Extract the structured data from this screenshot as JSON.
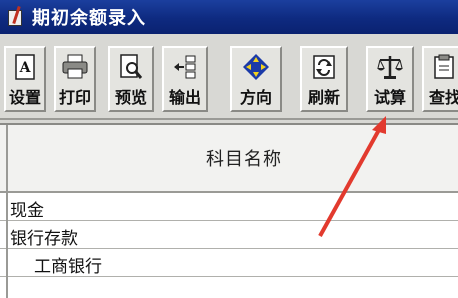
{
  "window": {
    "title": "期初余额录入"
  },
  "toolbar": {
    "buttons": [
      {
        "label": "设置",
        "icon": "settings-doc-icon"
      },
      {
        "label": "打印",
        "icon": "printer-icon"
      },
      {
        "label": "预览",
        "icon": "preview-icon"
      },
      {
        "label": "输出",
        "icon": "export-icon"
      },
      {
        "label": "方向",
        "icon": "direction-icon"
      },
      {
        "label": "刷新",
        "icon": "refresh-icon"
      },
      {
        "label": "试算",
        "icon": "balance-scale-icon"
      },
      {
        "label": "查找",
        "icon": "find-icon"
      }
    ]
  },
  "grid": {
    "column_header": "科目名称",
    "rows": [
      {
        "name": "现金"
      },
      {
        "name": "银行存款"
      },
      {
        "name": "工商银行"
      }
    ]
  },
  "annotation": {
    "arrow_color": "#e23a2e"
  },
  "colors": {
    "titlebar": "#0e2a80",
    "toolbar": "#d8d8d4"
  }
}
